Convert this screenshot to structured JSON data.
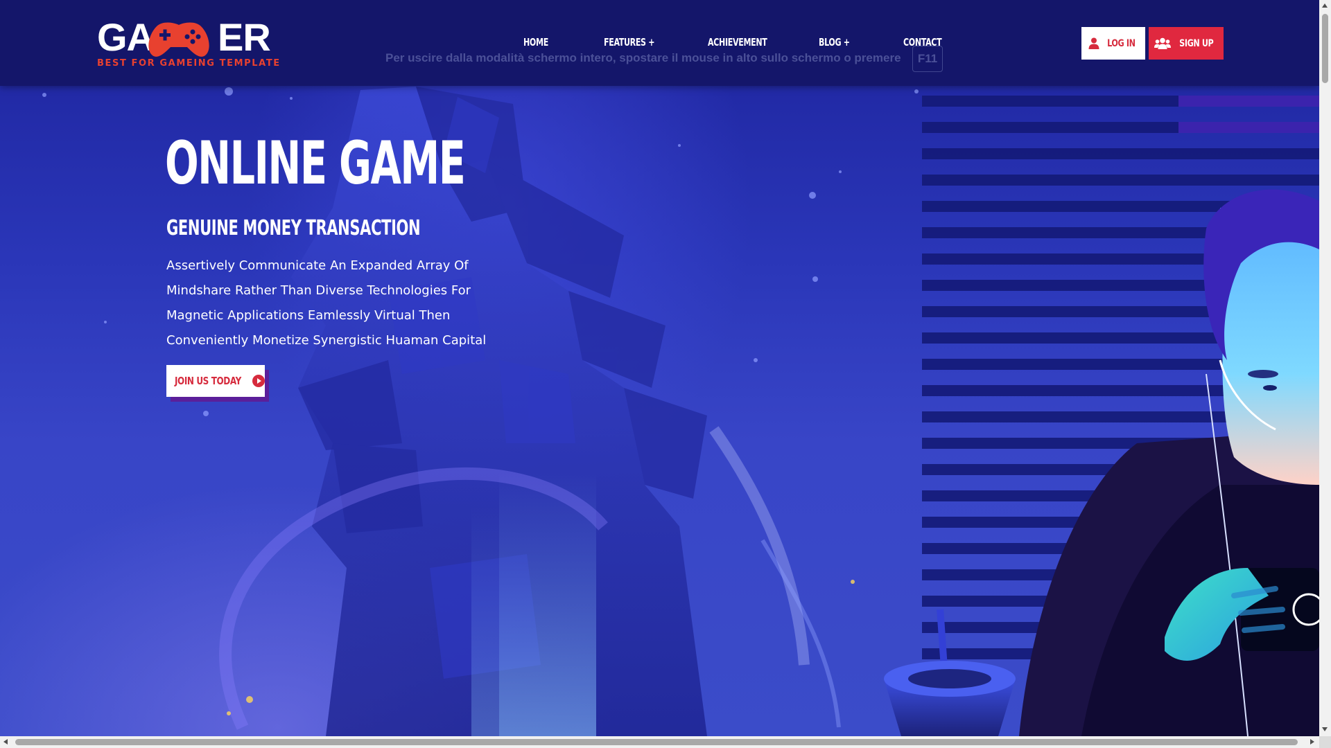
{
  "logo": {
    "word_left": "GA",
    "word_right": "ER",
    "tagline": "BEST FOR GAMEING TEMPLATE",
    "icon": "gamepad-icon",
    "accent_color": "#e8412f"
  },
  "nav": {
    "items": [
      {
        "label": "HOME"
      },
      {
        "label": "FEATURES +"
      },
      {
        "label": "ACHIEVEMENT"
      },
      {
        "label": "BLOG +"
      },
      {
        "label": "CONTACT"
      }
    ]
  },
  "fullscreen_hint": {
    "text": "Per uscire dalla modalità schermo intero, spostare il mouse in alto sullo schermo o premere",
    "key": "F11"
  },
  "auth": {
    "login_label": "LOG IN",
    "login_icon": "user-icon",
    "signup_label": "SIGN UP",
    "signup_icon": "users-icon",
    "accent_color": "#e0283f"
  },
  "hero": {
    "title": "ONLINE GAME",
    "subtitle": "GENUINE MONEY TRANSACTION",
    "body_lines": [
      "Assertively Communicate An Expanded Array Of",
      "Mindshare Rather Than Diverse Technologies For",
      "Magnetic Applications Eamlessly Virtual Then",
      "Conveniently Monetize Synergistic Huaman Capital"
    ],
    "cta_label": "JOIN US TODAY",
    "cta_icon": "play-circle-icon"
  },
  "colors": {
    "header_bg": "#14166a",
    "hero_bg": "#2a36b8",
    "cta_shadow": "#5b1f9a"
  }
}
